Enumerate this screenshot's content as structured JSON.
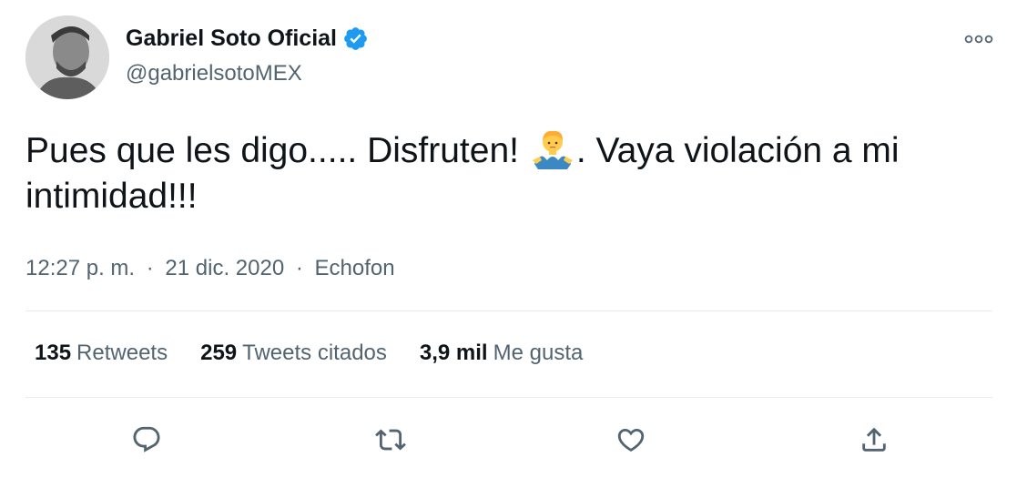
{
  "author": {
    "name": "Gabriel Soto Oficial",
    "handle": "@gabrielsotoMEX",
    "verified": true,
    "verified_color": "#1d9bf0"
  },
  "tweet": {
    "text_part1": "Pues que les digo..... Disfruten! ",
    "emoji": "person-shrugging",
    "text_part2": ". Vaya violación a mi intimidad!!!"
  },
  "meta": {
    "time": "12:27 p. m.",
    "separator": "·",
    "date": "21 dic. 2020",
    "source": "Echofon"
  },
  "stats": {
    "retweets_count": "135",
    "retweets_label": "Retweets",
    "quotes_count": "259",
    "quotes_label": "Tweets citados",
    "likes_count": "3,9 mil",
    "likes_label": "Me gusta"
  },
  "actions": {
    "icons": [
      "reply-icon",
      "retweet-icon",
      "like-icon",
      "share-icon"
    ]
  },
  "colors": {
    "text_primary": "#0f1419",
    "text_secondary": "#536471",
    "divider": "#e6ecf0"
  }
}
